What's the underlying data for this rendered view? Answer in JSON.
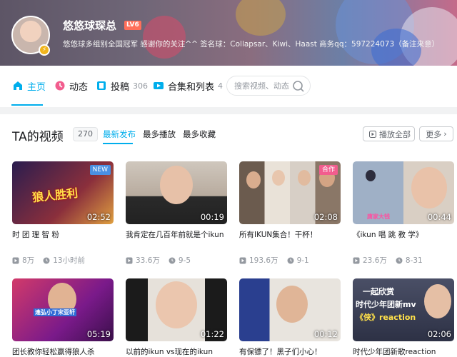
{
  "profile": {
    "username": "悠悠球琛总",
    "level": "LV6",
    "signature": "悠悠球多组别全国冠军 感谢你的关注^^ 签名球：Collapsar、Kiwi、Haast 商务qq：597224073（备注来意）"
  },
  "nav": {
    "items": [
      {
        "label": "主页",
        "icon": "home-icon"
      },
      {
        "label": "动态",
        "icon": "dynamic-icon"
      },
      {
        "label": "投稿",
        "icon": "upload-icon",
        "count": "306"
      },
      {
        "label": "合集和列表",
        "icon": "playlist-icon",
        "count": "4"
      }
    ],
    "search_placeholder": "搜索视频、动态"
  },
  "section": {
    "title": "TA的视频",
    "count": "270",
    "sorts": [
      "最新发布",
      "最多播放",
      "最多收藏"
    ],
    "play_all": "播放全部",
    "more": "更多"
  },
  "colors": {
    "accent": "#00aeec",
    "new_tag": "#4a90e2",
    "coop_tag": "#f25d8e"
  },
  "videos": [
    {
      "title": "时 团 理 智 粉",
      "duration": "02:52",
      "plays": "8万",
      "time": "13小时前",
      "tag": "NEW",
      "thumb_text": "狼人胜利"
    },
    {
      "title": "我肯定在几百年前就是个ikun",
      "duration": "00:19",
      "plays": "33.6万",
      "time": "9-5"
    },
    {
      "title": "所有IKUN集合！干杯！",
      "duration": "02:08",
      "plays": "193.6万",
      "time": "9-1",
      "tag": "合作"
    },
    {
      "title": "《ikun 唱 跳 教 学》",
      "duration": "00:44",
      "plays": "23.6万",
      "time": "8-31",
      "thumb_text": "唐家大钱"
    },
    {
      "title": "团长教你轻松赢得狼人杀",
      "duration": "05:19",
      "thumb_text": "逢弘小丁宋亚轩"
    },
    {
      "title": "以前的ikun vs现在的ikun",
      "duration": "01:22"
    },
    {
      "title": "有保镖了！黑子们小心！",
      "duration": "00:12"
    },
    {
      "title": "时代少年团新歌reaction",
      "duration": "02:06",
      "thumb_text": "一起欣赏",
      "thumb_text2": "时代少年团新mv",
      "thumb_text3": "《侠》reaction"
    }
  ]
}
